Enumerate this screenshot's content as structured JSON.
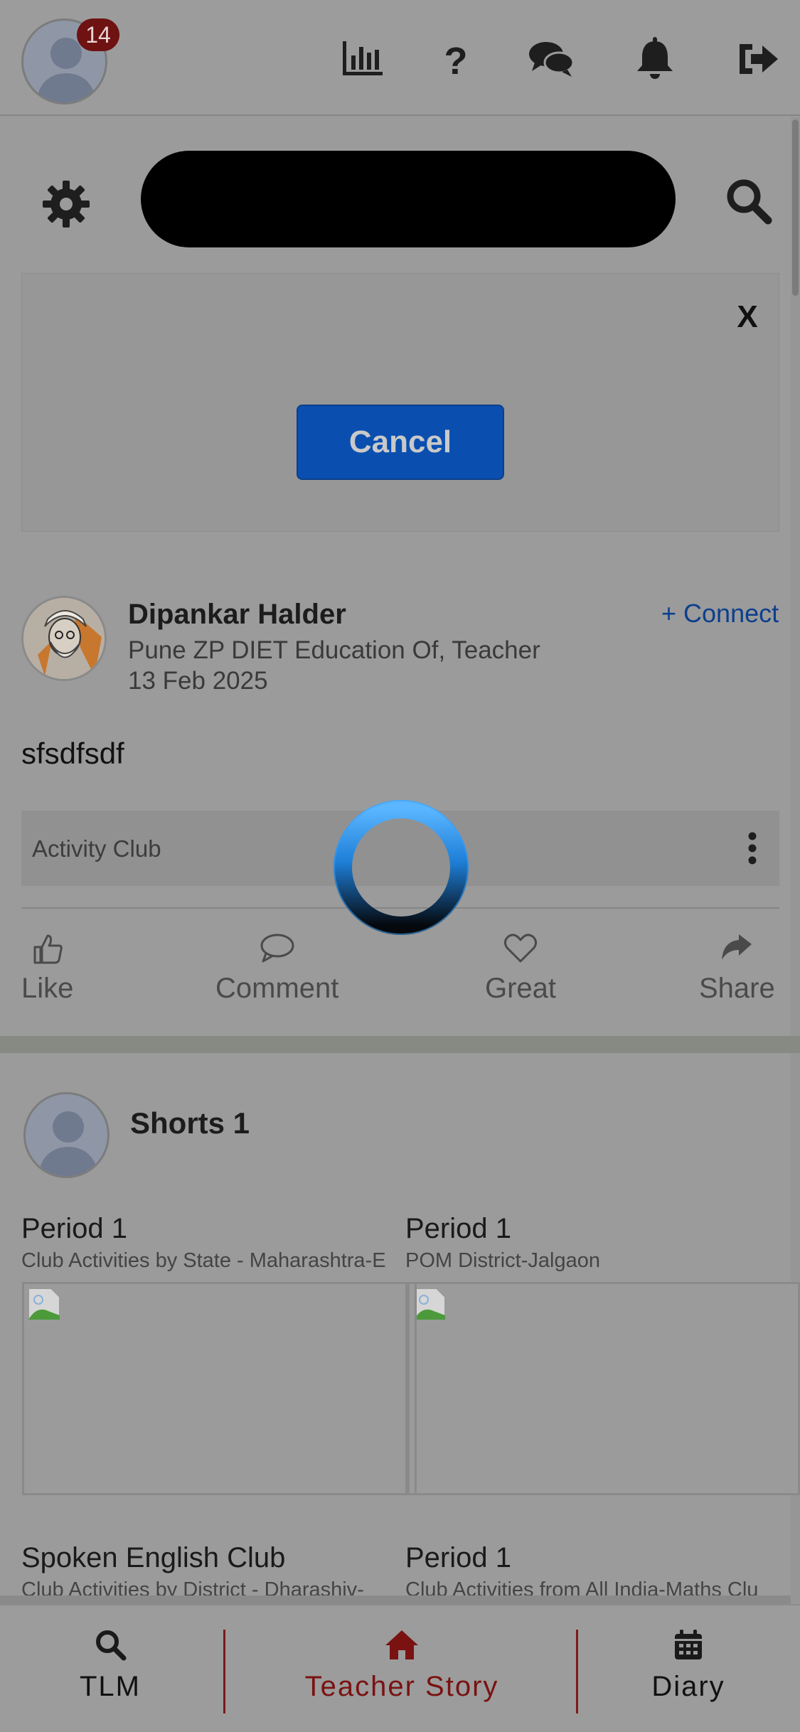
{
  "header": {
    "notification_count": "14",
    "icons": [
      "stats-icon",
      "help-icon",
      "chat-icon",
      "bell-icon",
      "logout-icon"
    ]
  },
  "search": {
    "value": "",
    "placeholder": ""
  },
  "modal": {
    "close_label": "X",
    "cancel_label": "Cancel"
  },
  "post": {
    "author": "Dipankar Halder",
    "connect_label": "+ Connect",
    "role": "Pune ZP DIET Education Of, Teacher",
    "date": "13 Feb 2025",
    "text": "sfsdfsdf",
    "club": "Activity Club",
    "actions": [
      {
        "label": "Like",
        "icon": "thumbs-up-icon"
      },
      {
        "label": "Comment",
        "icon": "comment-icon"
      },
      {
        "label": "Great",
        "icon": "heart-icon"
      },
      {
        "label": "Share",
        "icon": "share-icon"
      }
    ]
  },
  "shorts": {
    "title": "Shorts 1",
    "cards": [
      {
        "title": "Period 1",
        "subtitle": "Club Activities by State - Maharashtra-E"
      },
      {
        "title": "Period 1",
        "subtitle": "POM District-Jalgaon"
      },
      {
        "title": "Spoken English Club",
        "subtitle": "Club Activities by District - Dharashiv-"
      },
      {
        "title": "Period 1",
        "subtitle": "Club Activities from All India-Maths Clu"
      }
    ]
  },
  "bottom_nav": {
    "items": [
      {
        "label": "TLM",
        "icon": "search-icon"
      },
      {
        "label": "Teacher Story",
        "icon": "home-icon",
        "active": true
      },
      {
        "label": "Diary",
        "icon": "calendar-icon"
      }
    ],
    "active_color": "#7a1212"
  },
  "colors": {
    "overlay_bg": "#9b9b9b",
    "primary_button": "#0a4fb0",
    "link": "#0c3f8d",
    "badge": "#6e1212",
    "spinner": "#1e90ff"
  }
}
